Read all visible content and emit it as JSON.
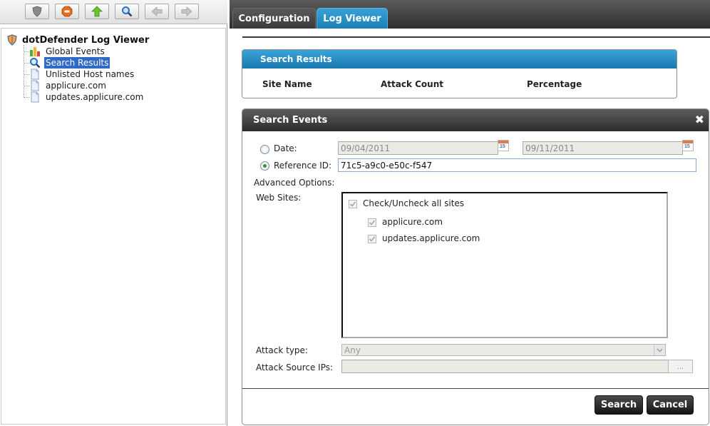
{
  "toolbar": {
    "buttons": [
      {
        "name": "shield-icon"
      },
      {
        "name": "stop-icon",
        "color": "#e06a1a"
      },
      {
        "name": "up-arrow-icon",
        "color": "#5cbf2a"
      },
      {
        "name": "magnifier-icon",
        "color": "#2a6fc4"
      },
      {
        "name": "back-arrow-icon",
        "state": "disabled"
      },
      {
        "name": "forward-arrow-icon",
        "state": "disabled"
      }
    ]
  },
  "tree": {
    "root_label": "dotDefender Log Viewer",
    "items": [
      {
        "label": "Global Events",
        "icon": "chart-icon"
      },
      {
        "label": "Search Results",
        "icon": "magnifier-icon",
        "selected": true
      },
      {
        "label": "Unlisted Host names",
        "icon": "document-icon"
      },
      {
        "label": "applicure.com",
        "icon": "document-icon"
      },
      {
        "label": "updates.applicure.com",
        "icon": "document-icon"
      }
    ]
  },
  "tabs": [
    {
      "label": "Configuration",
      "active": false
    },
    {
      "label": "Log Viewer",
      "active": true
    }
  ],
  "results": {
    "title": "Search Results",
    "columns": [
      "Site Name",
      "Attack Count",
      "Percentage"
    ]
  },
  "search": {
    "title": "Search Events",
    "close_glyph": "✖",
    "date_label": "Date:",
    "date_from": "09/04/2011",
    "date_to": "09/11/2011",
    "calendar_day": "15",
    "refid_label": "Reference ID:",
    "refid_value": "71c5-a9c0-e50c-f547",
    "selected_mode": "reference_id",
    "advanced_label": "Advanced Options:",
    "websites_label": "Web Sites:",
    "check_all_label": "Check/Uncheck all sites",
    "sites": [
      "applicure.com",
      "updates.applicure.com"
    ],
    "attack_type_label": "Attack type:",
    "attack_type_value": "Any",
    "source_ips_label": "Attack Source IPs:",
    "source_ips_value": "",
    "browse_label": "...",
    "search_button": "Search",
    "cancel_button": "Cancel"
  },
  "colors": {
    "accent_blue": "#1f86c0",
    "selection_blue": "#3169c6",
    "dark_header": "#3a3a3a"
  }
}
